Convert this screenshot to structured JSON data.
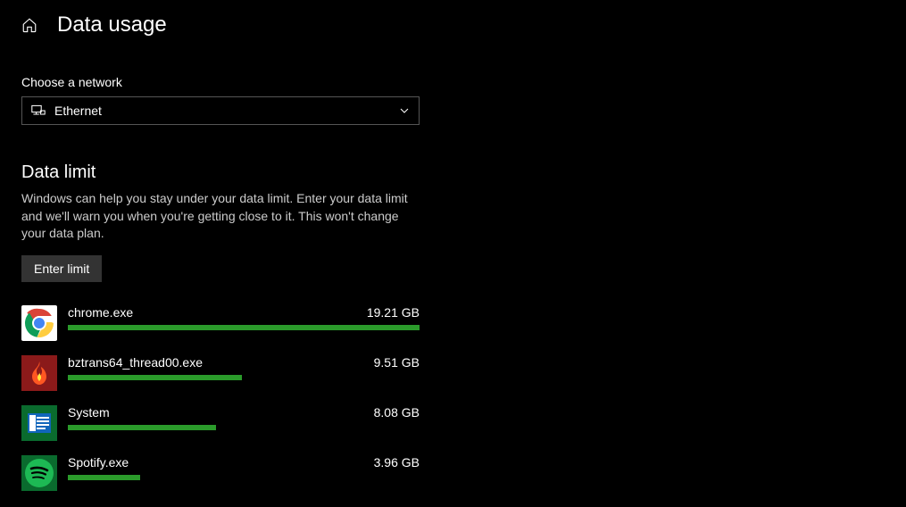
{
  "page": {
    "title": "Data usage"
  },
  "network_selector": {
    "label": "Choose a network",
    "selected": "Ethernet"
  },
  "data_limit": {
    "title": "Data limit",
    "description": "Windows can help you stay under your data limit. Enter your data limit and we'll warn you when you're getting close to it. This won't change your data plan.",
    "button": "Enter limit"
  },
  "apps": [
    {
      "name": "chrome.exe",
      "usage": "19.21 GB",
      "pct": 100,
      "icon": "chrome"
    },
    {
      "name": "bztrans64_thread00.exe",
      "usage": "9.51 GB",
      "pct": 49.5,
      "icon": "bz"
    },
    {
      "name": "System",
      "usage": "8.08 GB",
      "pct": 42.1,
      "icon": "system"
    },
    {
      "name": "Spotify.exe",
      "usage": "3.96 GB",
      "pct": 20.6,
      "icon": "spotify"
    }
  ]
}
